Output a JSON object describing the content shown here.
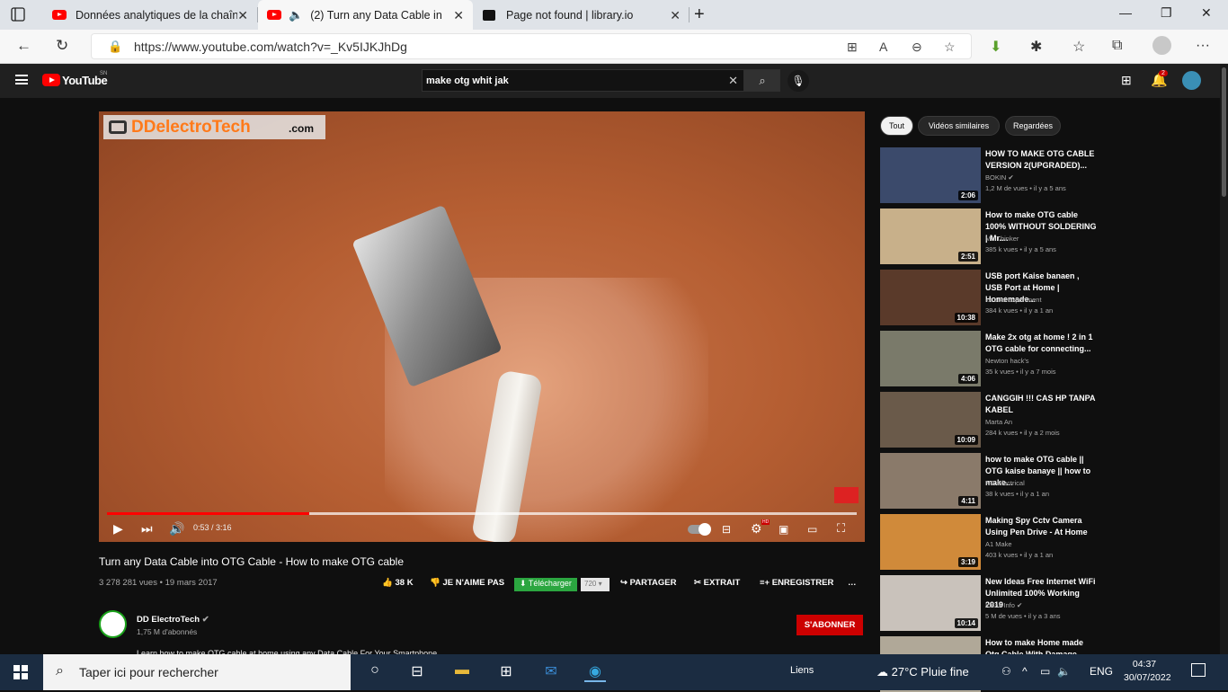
{
  "browser": {
    "tabs": [
      {
        "title": "Données analytiques de la chaîne",
        "active": false
      },
      {
        "title": "(2) Turn any Data Cable into OTG Cable",
        "active": true
      },
      {
        "title": "Page not found | library.io",
        "active": false
      }
    ],
    "url": "https://www.youtube.com/watch?v=_Kv5IJKJhDg"
  },
  "youtube": {
    "logo_text": "YouTube",
    "country_code": "SN",
    "search_value": "make otg whit jak",
    "notification_count": "2"
  },
  "player": {
    "watermark_main": "DDelectroTech",
    "watermark_tld": ".com",
    "time": "0:53 / 3:16",
    "progress_fraction": 0.27,
    "loaded_fraction": 1.0,
    "hd_badge": "HD"
  },
  "video": {
    "title": "Turn any Data Cable into OTG Cable - How to make OTG cable",
    "meta": "3 278 281 vues • 19 mars 2017",
    "likes": "38 K",
    "dislike_label": "JE N'AIME PAS",
    "download_label": "Télécharger",
    "download_quality": "720",
    "share_label": "PARTAGER",
    "clip_label": "EXTRAIT",
    "save_label": "ENREGISTRER",
    "more_label": "…"
  },
  "channel": {
    "name": "DD ElectroTech",
    "subscribers": "1,75 M d'abonnés",
    "subscribe_label": "S'ABONNER",
    "description": "Learn how to make OTG cable at home using any Data Cable For Your Smartphone"
  },
  "chips": [
    "Tout",
    "Vidéos similaires",
    "Regardées"
  ],
  "recommendations": [
    {
      "title": "HOW TO MAKE OTG CABLE VERSION 2(UPGRADED)...",
      "channel": "BOKIN",
      "verified": true,
      "meta": "1,2 M de vues • il y a 5 ans",
      "duration": "2:06",
      "thumb_color": "#3b4a6b"
    },
    {
      "title": "How to make OTG cable 100% WITHOUT SOLDERING | Mr....",
      "channel": "Mr. Thinker",
      "verified": false,
      "meta": "385 k vues • il y a 5 ans",
      "duration": "2:51",
      "thumb_color": "#c8b08a"
    },
    {
      "title": "USB port Kaise banaen , USB Port at Home | Homemade...",
      "channel": "kk cool experiment",
      "verified": false,
      "meta": "384 k vues • il y a 1 an",
      "duration": "10:38",
      "thumb_color": "#5a3a2a"
    },
    {
      "title": "Make 2x otg at home ! 2 in 1 OTG cable for connecting...",
      "channel": "Newton hack's",
      "verified": false,
      "meta": "35 k vues • il y a 7 mois",
      "duration": "4:06",
      "thumb_color": "#7a7a6a"
    },
    {
      "title": "CANGGIH !!! CAS HP TANPA KABEL",
      "channel": "Marta An",
      "verified": false,
      "meta": "284 k vues • il y a 2 mois",
      "duration": "10:09",
      "thumb_color": "#6a5a4a"
    },
    {
      "title": "how to make OTG cable || OTG kaise banaye || how to make...",
      "channel": "NG Electrical",
      "verified": false,
      "meta": "38 k vues • il y a 1 an",
      "duration": "4:11",
      "thumb_color": "#8a7a6a"
    },
    {
      "title": "Making Spy Cctv Camera Using Pen Drive - At Home",
      "channel": "A1 Make",
      "verified": false,
      "meta": "403 k vues • il y a 1 an",
      "duration": "3:19",
      "thumb_color": "#d08a3a"
    },
    {
      "title": "New Ideas Free Internet WiFi Unlimited 100% Working 2019",
      "channel": "Ideas Info",
      "verified": true,
      "meta": "5 M de vues • il y a 3 ans",
      "duration": "10:14",
      "thumb_color": "#c9c2bb"
    },
    {
      "title": "How to make Home made Otg Cable With Damage Charger ||",
      "channel": "",
      "verified": false,
      "meta": "",
      "duration": "",
      "thumb_color": "#b0a898"
    }
  ],
  "taskbar": {
    "search_placeholder": "Taper ici pour rechercher",
    "links_label": "Liens",
    "weather": "27°C  Pluie fine",
    "language": "ENG",
    "time": "04:37",
    "date": "30/07/2022"
  }
}
